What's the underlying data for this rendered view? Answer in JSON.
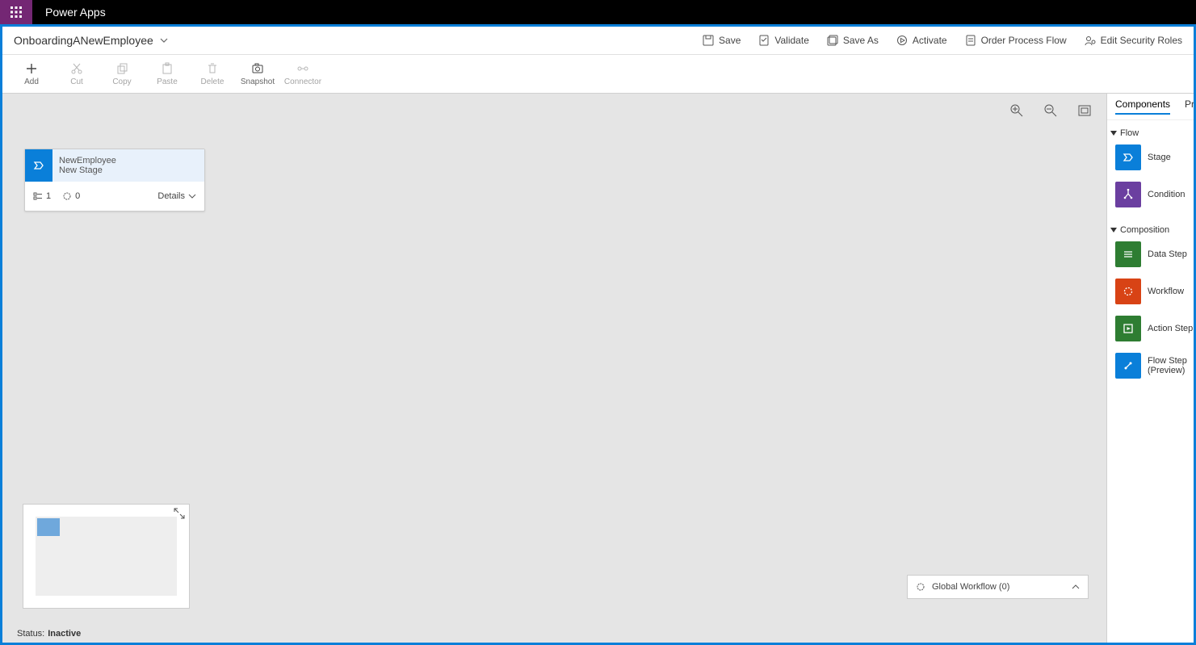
{
  "app": {
    "title": "Power Apps"
  },
  "process": {
    "name": "OnboardingANewEmployee"
  },
  "procActions": {
    "save": "Save",
    "validate": "Validate",
    "saveAs": "Save As",
    "activate": "Activate",
    "order": "Order Process Flow",
    "editSec": "Edit Security Roles"
  },
  "toolbar": {
    "add": "Add",
    "cut": "Cut",
    "copy": "Copy",
    "paste": "Paste",
    "delete": "Delete",
    "snapshot": "Snapshot",
    "connector": "Connector"
  },
  "stage": {
    "entity": "NewEmployee",
    "name": "New Stage",
    "stepCount": "1",
    "wfCount": "0",
    "details": "Details"
  },
  "globalWf": {
    "label": "Global Workflow (0)"
  },
  "status": {
    "label": "Status:",
    "value": "Inactive"
  },
  "panel": {
    "tabComponents": "Components",
    "tabPro": "Pro",
    "groupFlow": "Flow",
    "groupComposition": "Composition",
    "stage": "Stage",
    "condition": "Condition",
    "dataStep": "Data Step",
    "workflow": "Workflow",
    "actionStep": "Action Step",
    "flowStepL1": "Flow Step",
    "flowStepL2": "(Preview)"
  }
}
